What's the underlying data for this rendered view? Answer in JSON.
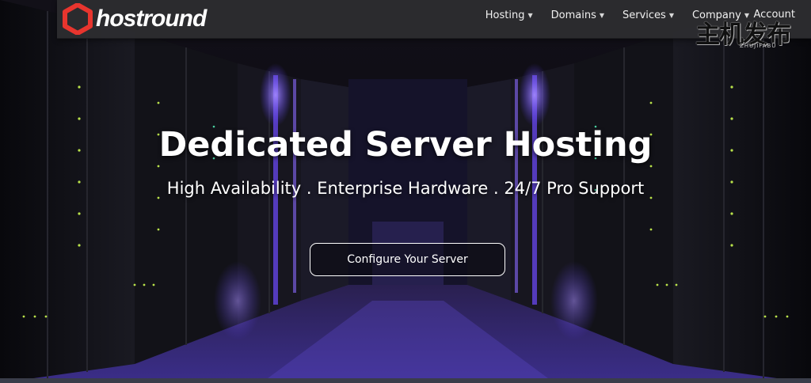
{
  "brand": {
    "name": "hostround",
    "logo_icon": "hexagon-ring-icon",
    "accent_color": "#e8352e"
  },
  "nav": {
    "items": [
      {
        "label": "Hosting",
        "has_dropdown": true
      },
      {
        "label": "Domains",
        "has_dropdown": true
      },
      {
        "label": "Services",
        "has_dropdown": true
      },
      {
        "label": "Company",
        "has_dropdown": true
      }
    ],
    "account_label": "Account",
    "caret_glyph": "▼"
  },
  "hero": {
    "title": "Dedicated Server Hosting",
    "subtitle": "High Availability . Enterprise Hardware . 24/7 Pro Support",
    "cta_label": "Configure Your Server"
  },
  "watermark": {
    "text": "主机发布",
    "sub": "ZHUJIFABU"
  }
}
